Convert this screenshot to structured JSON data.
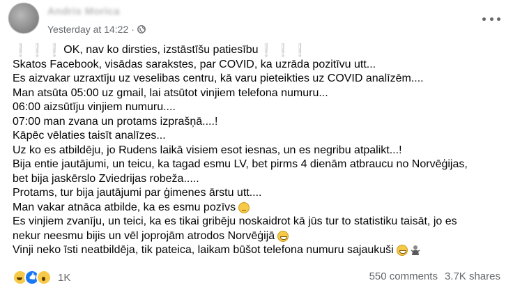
{
  "post": {
    "author": "Andris Morica",
    "time": "Yesterday at 14:22",
    "separator": "·",
    "lines": [
      " OK, nav ko dirsties, izstāstīšu patiesību ",
      "Skatos Facebook, visādas sarakstes, par COVID, ka uzrāda pozitīvu utt...",
      "Es aizvakar uzraxtīju uz veselibas centru, kā varu pieteikties uz COVID analīzēm....",
      "Man atsūta 05:00 uz gmail, lai atsūtot vinjiem telefona numuru...",
      "06:00 aizsūtīju vinjiem numuru....",
      "07:00 man zvana un protams izprašņā....!",
      "Kāpēc vēlaties taisīt analīzes...",
      "Uz ko es atbildēju, jo Rudens laikā visiem esot iesnas, un es negribu atpalikt...!",
      "Bija entie jautājumi, un teicu, ka tagad esmu LV, bet pirms 4 dienām atbraucu no Norvēģijas,",
      "bet bija jaskērslo Zviedrijas robeža.....",
      "Protams, tur bija jautājumi par ģimenes ārstu utt....",
      "Man vakar atnāca atbilde, ka es esmu pozīvs",
      "Es vinjiem zvanīju, un teici, ka es tikai gribēju noskaidrot kā jūs tur to statistiku taisāt, jo es",
      "nekur neesmu bijis un vēl joprojām atrodos Norvēģijā",
      "Vinji neko īsti neatbildēja, tik pateica, laikam būšot telefona numuru sajaukuši"
    ],
    "bangs": "❕❕❕"
  },
  "footer": {
    "reaction_count": "1K",
    "comments": "550 comments",
    "shares": "3.7K shares"
  },
  "icons": {
    "globe": "globe-icon",
    "more": "more-options-icon"
  }
}
